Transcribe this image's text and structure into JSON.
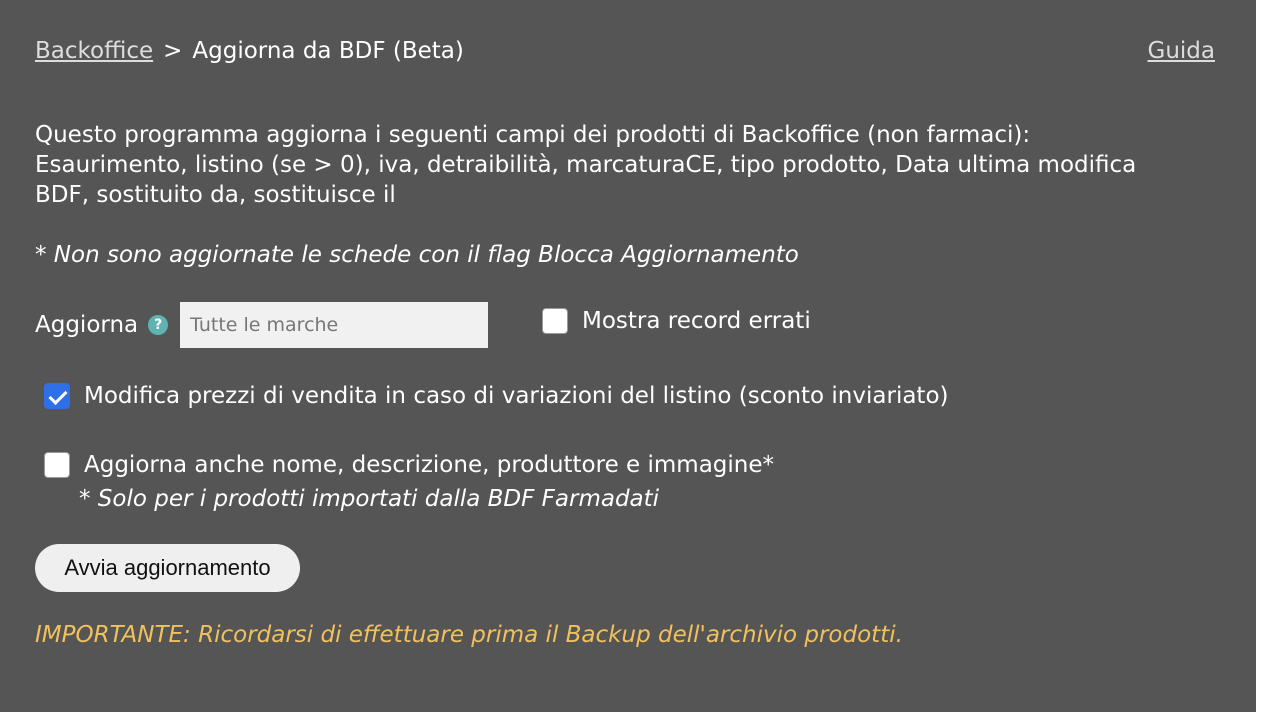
{
  "header": {
    "breadcrumb_link": "Backoffice",
    "breadcrumb_separator": ">",
    "page_title": "Aggiorna da BDF (Beta)",
    "help_link": "Guida"
  },
  "intro": {
    "line1": "Questo programma aggiorna i seguenti campi dei prodotti di Backoffice (non farmaci):",
    "line2": "Esaurimento, listino (se > 0), iva, detraibilità, marcaturaCE, tipo prodotto, Data ultima modifica",
    "line3": "BDF, sostituito da, sostituisce il"
  },
  "note": "* Non sono aggiornate le schede con il flag Blocca Aggiornamento",
  "update": {
    "label": "Aggiorna",
    "help_glyph": "?",
    "brand_placeholder": "Tutte le marche",
    "brand_value": ""
  },
  "show_errors": {
    "label": "Mostra record errati",
    "checked": false
  },
  "option_prices": {
    "label": "Modifica prezzi di vendita in caso di variazioni del listino (sconto inviariato)",
    "checked": true
  },
  "option_names": {
    "label": "Aggiorna anche nome, descrizione, produttore e immagine*",
    "note": "* Solo per i prodotti importati dalla BDF Farmadati",
    "checked": false
  },
  "start_button": "Avvia aggiornamento",
  "warning": "IMPORTANTE: Ricordarsi di effettuare prima il Backup dell'archivio prodotti.",
  "colors": {
    "panel_bg": "#555555",
    "checkbox_accent": "#2f6fe8",
    "warning_text": "#f2c15c",
    "help_icon": "#5fb3b3"
  }
}
